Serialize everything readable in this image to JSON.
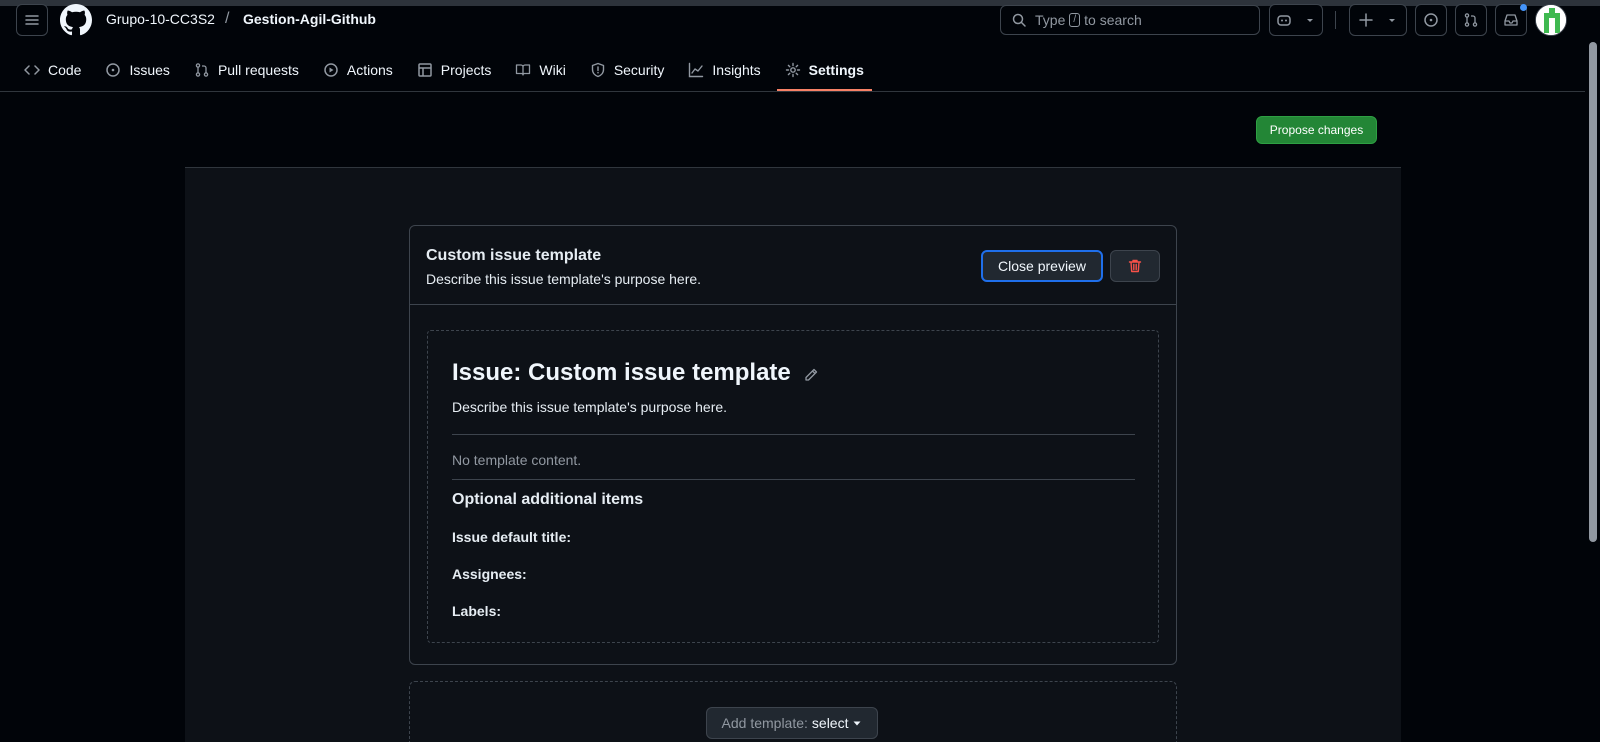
{
  "header": {
    "owner": "Grupo-10-CC3S2",
    "separator": "/",
    "repo": "Gestion-Agil-Github",
    "search_prefix": "Type",
    "search_key": "/",
    "search_suffix": "to search"
  },
  "tabs": [
    {
      "label": "Code",
      "icon": "code-icon"
    },
    {
      "label": "Issues",
      "icon": "issue-opened-icon"
    },
    {
      "label": "Pull requests",
      "icon": "git-pull-request-icon"
    },
    {
      "label": "Actions",
      "icon": "play-icon"
    },
    {
      "label": "Projects",
      "icon": "table-icon"
    },
    {
      "label": "Wiki",
      "icon": "book-icon"
    },
    {
      "label": "Security",
      "icon": "shield-icon"
    },
    {
      "label": "Insights",
      "icon": "graph-icon"
    },
    {
      "label": "Settings",
      "icon": "gear-icon",
      "active": true
    }
  ],
  "toolbar": {
    "propose_label": "Propose changes"
  },
  "template_card": {
    "title": "Custom issue template",
    "description": "Describe this issue template's purpose here.",
    "close_preview_label": "Close preview"
  },
  "preview": {
    "title": "Issue: Custom issue template",
    "description": "Describe this issue template's purpose here.",
    "empty_text": "No template content.",
    "section_title": "Optional additional items",
    "fields": {
      "default_title": "Issue default title:",
      "assignees": "Assignees:",
      "labels": "Labels:"
    }
  },
  "add_template": {
    "label": "Add template:",
    "value": "select"
  },
  "colors": {
    "accent_tab": "#f78166",
    "primary_button": "#238636",
    "focus_ring": "#1f6feb",
    "danger": "#f85149"
  }
}
